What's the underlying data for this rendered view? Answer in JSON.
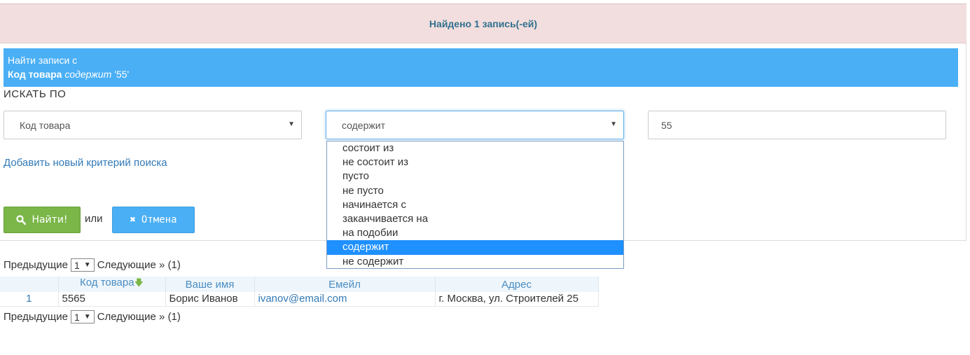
{
  "banner": {
    "found_text": "Найдено 1 запись(-ей)"
  },
  "criteria": {
    "header": "Найти записи с",
    "field": "Код товара",
    "operator": "содержит",
    "value": "'55'"
  },
  "search_by_label": "ИСКАТЬ ПО",
  "filter": {
    "field_selected": "Код товара",
    "operator_selected": "содержит",
    "value": "55",
    "operator_options": [
      "состоит из",
      "не состоит из",
      "пусто",
      "не пусто",
      "начинается с",
      "заканчивается на",
      "на подобии",
      "содержит",
      "не содержит"
    ],
    "selected_index": 7
  },
  "add_criteria_link": "Добавить новый критерий поиска",
  "buttons": {
    "find": "Найти!",
    "or": "или",
    "cancel": "Отмена"
  },
  "pager": {
    "prev": "Предыдущие",
    "page": "1",
    "next": "Следующие »",
    "total": "(1)"
  },
  "table": {
    "columns": [
      "",
      "Код товара",
      "Ваше имя",
      "Емейл",
      "Адрес"
    ],
    "rows": [
      {
        "num": "1",
        "code": "5565",
        "name": "Борис Иванов",
        "email": "ivanov@email.com",
        "address": "г. Москва, ул. Строителей 25"
      }
    ]
  },
  "colors": {
    "accent": "#4aaff5",
    "success": "#7ab648",
    "banner_bg": "#f2dede",
    "selected_option": "#1e90ff"
  }
}
